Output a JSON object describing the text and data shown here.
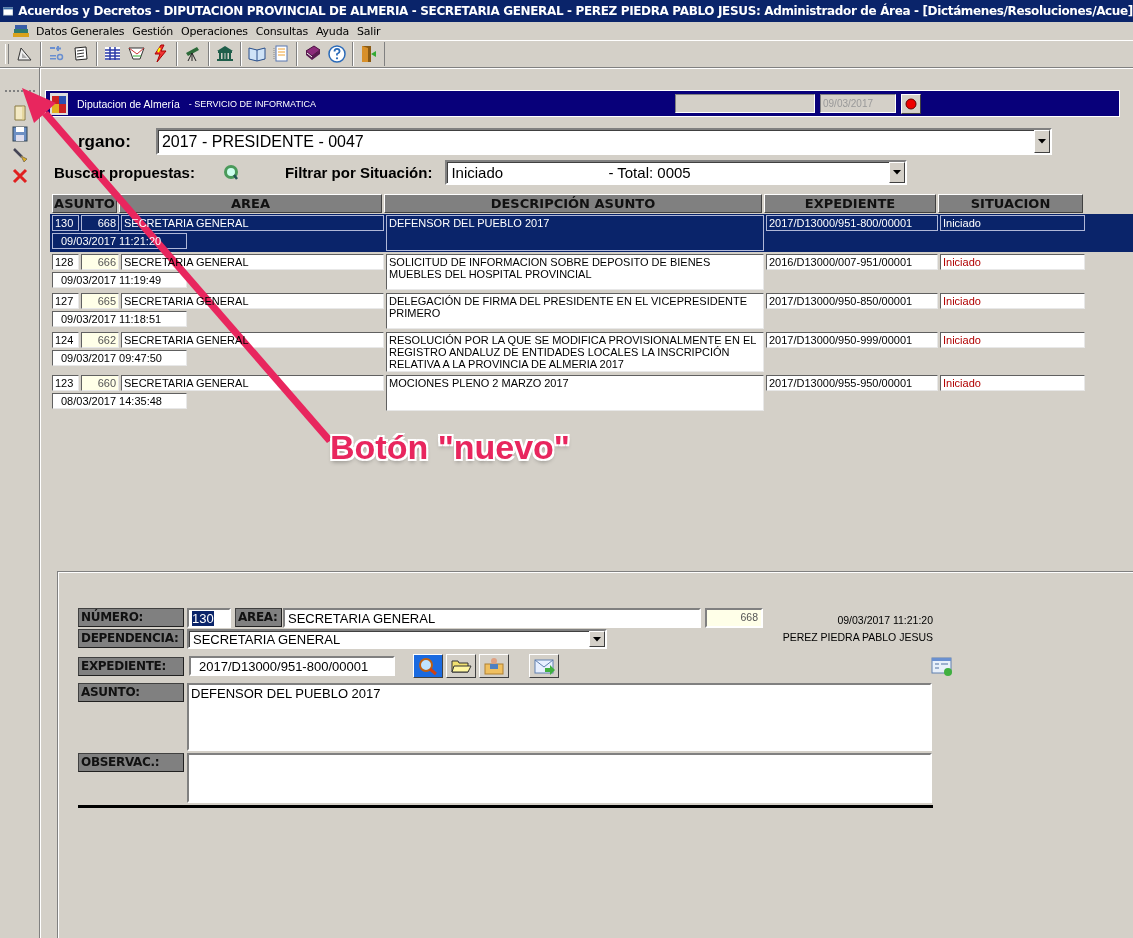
{
  "window": {
    "title": "Acuerdos y Decretos - DIPUTACION PROVINCIAL DE ALMERIA - SECRETARIA GENERAL - PEREZ PIEDRA PABLO JESUS: Administrador de Área - [Dictámenes/Resoluciones/Acue]"
  },
  "menu": [
    {
      "label": "Datos Generales"
    },
    {
      "label": "Gestión"
    },
    {
      "label": "Operaciones"
    },
    {
      "label": "Consultas"
    },
    {
      "label": "Ayuda"
    },
    {
      "label": "Salir"
    }
  ],
  "banner": {
    "organization": "Diputacion de Almería",
    "service": "- SERVICIO DE INFORMATICA",
    "date": "09/03/2017"
  },
  "organo": {
    "label": "rgano:",
    "value": "2017 - PRESIDENTE - 0047"
  },
  "search": {
    "label": "Buscar propuestas:",
    "filter_label": "Filtrar por Situación:",
    "filter_value": "Iniciado",
    "total": "- Total: 0005"
  },
  "table": {
    "columns": [
      "ASUNTO",
      "AREA",
      "DESCRIPCIÓN ASUNTO",
      "EXPEDIENTE",
      "SITUACION"
    ],
    "rows": [
      {
        "asunto": "130",
        "number": "668",
        "area": "SECRETARIA GENERAL",
        "description": "DEFENSOR DEL PUEBLO 2017",
        "expediente": "2017/D13000/951-800/00001",
        "situacion": "Iniciado",
        "date": "09/03/2017 11:21:20",
        "selected": true
      },
      {
        "asunto": "128",
        "number": "666",
        "area": "SECRETARIA GENERAL",
        "description": "SOLICITUD DE INFORMACION SOBRE DEPOSITO DE BIENES MUEBLES DEL HOSPITAL PROVINCIAL",
        "expediente": "2016/D13000/007-951/00001",
        "situacion": "Iniciado",
        "date": "09/03/2017 11:19:49",
        "selected": false
      },
      {
        "asunto": "127",
        "number": "665",
        "area": "SECRETARIA GENERAL",
        "description": "DELEGACIÓN DE FIRMA DEL PRESIDENTE EN EL VICEPRESIDENTE PRIMERO",
        "expediente": "2017/D13000/950-850/00001",
        "situacion": "Iniciado",
        "date": "09/03/2017 11:18:51",
        "selected": false
      },
      {
        "asunto": "124",
        "number": "662",
        "area": "SECRETARIA GENERAL",
        "description": "RESOLUCIÓN POR LA QUE SE MODIFICA PROVISIONALMENTE EN EL REGISTRO ANDALUZ DE ENTIDADES LOCALES LA INSCRIPCIÓN RELATIVA A LA PROVINCIA DE ALMERIA 2017",
        "expediente": "2017/D13000/950-999/00001",
        "situacion": "Iniciado",
        "date": "09/03/2017 09:47:50",
        "selected": false
      },
      {
        "asunto": "123",
        "number": "660",
        "area": "SECRETARIA GENERAL",
        "description": "MOCIONES PLENO 2 MARZO 2017",
        "expediente": "2017/D13000/955-950/00001",
        "situacion": "Iniciado",
        "date": "08/03/2017 14:35:48",
        "selected": false
      }
    ]
  },
  "form": {
    "numero": {
      "label": "NÚMERO:",
      "value": "130"
    },
    "area": {
      "label": "AREA:",
      "value": "SECRETARIA GENERAL"
    },
    "code": "668",
    "timestamp": "09/03/2017 11:21:20",
    "user": "PEREZ PIEDRA PABLO JESUS",
    "dependencia": {
      "label": "DEPENDENCIA:",
      "value": "SECRETARIA GENERAL"
    },
    "expediente": {
      "label": "EXPEDIENTE:",
      "value": "2017/D13000/951-800/00001"
    },
    "asunto": {
      "label": "ASUNTO:",
      "value": "DEFENSOR DEL PUEBLO 2017"
    },
    "observaciones": {
      "label": "OBSERVAC.:"
    }
  },
  "annotation": {
    "text": "Botón \"nuevo\""
  }
}
